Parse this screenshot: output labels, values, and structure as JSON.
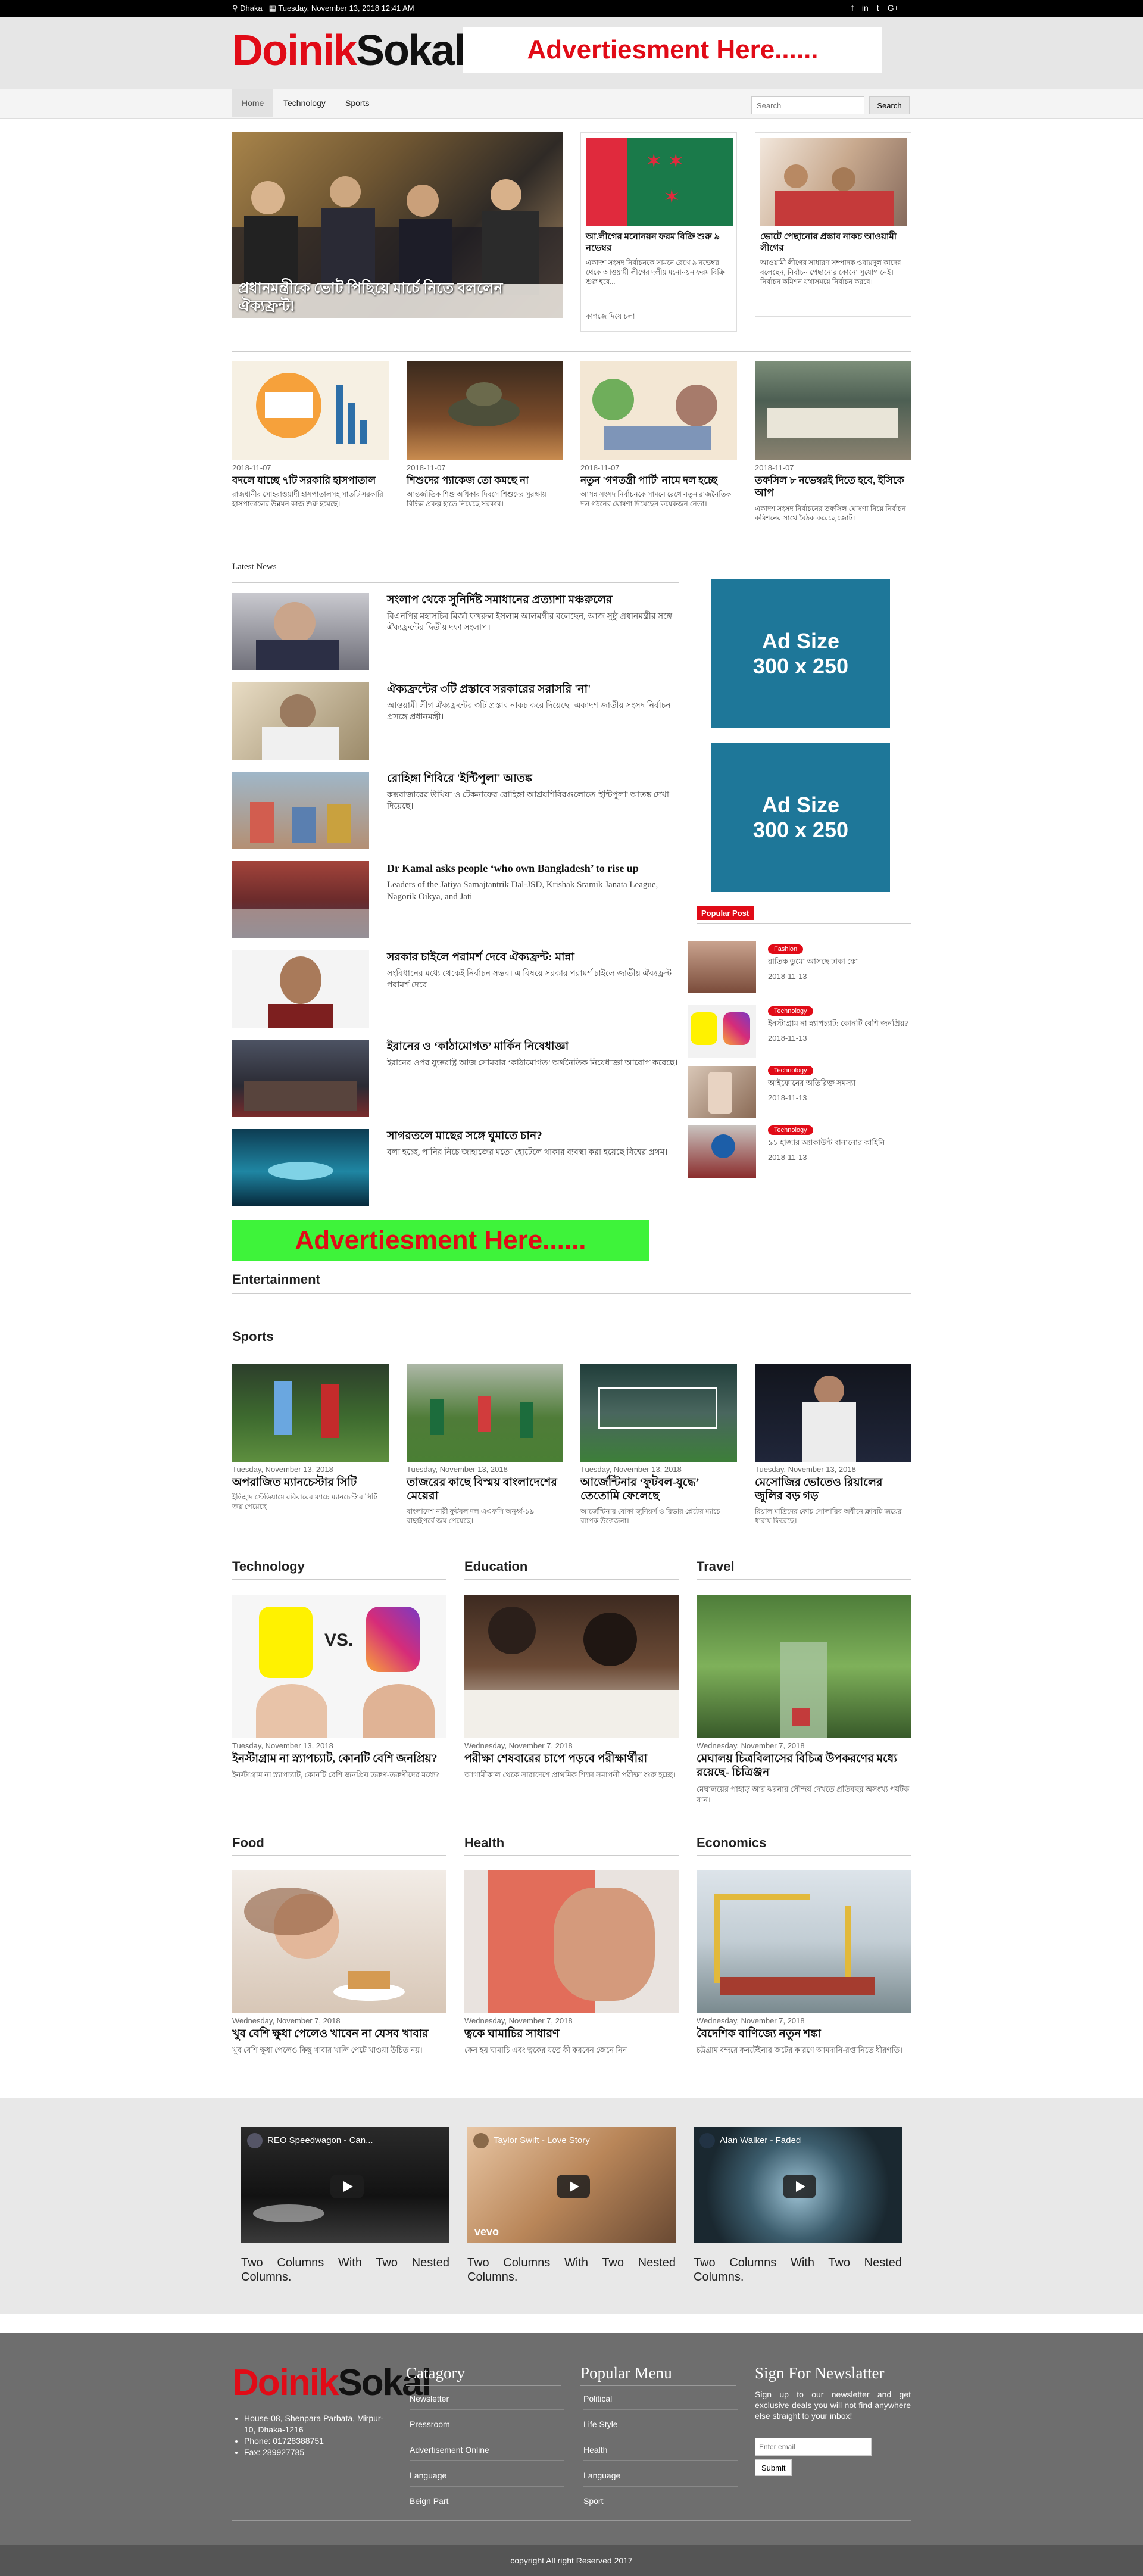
{
  "topbar": {
    "location": "Dhaka",
    "date": "Tuesday, November 13, 2018 12:41 AM",
    "social": [
      "f",
      "in",
      "t",
      "G+"
    ]
  },
  "brand": {
    "logo_red": "Doinik",
    "logo_black": "Sokal",
    "ad_top": "Advertiesment Here......"
  },
  "nav": {
    "items": [
      "Home",
      "Technology",
      "Sports"
    ],
    "search_placeholder": "Search",
    "search_button": "Search"
  },
  "lead": {
    "main_caption": "প্রধানমন্ত্রীকে ভোট পিছিয়ে মার্চে নিতে বললেন ঐক্যফ্রন্ট!",
    "cards": [
      {
        "title": "আ.লীগের মনোনয়ন ফরম বিক্রি শুরু ৯ নভেম্বর",
        "body": "একাদশ সংসদ নির্বাচনকে সামনে রেখে ৯ নভেম্বর থেকে আওয়ামী লীগের দলীয় মনোনয়ন ফরম বিক্রি শুরু হবে...",
        "date": "কাগজে দিয়ে চলা"
      },
      {
        "title": "ভোটে পেছানোর প্রস্তাব নাকচ আওয়ামী লীগের",
        "body": "আওয়ামী লীগের সাধারণ সম্পাদক ওবায়দুল কাদের বলেছেন, নির্বাচন পেছানোর কোনো সুযোগ নেই। নির্বাচন কমিশন যথাসময়ে নির্বাচন করবে।"
      }
    ]
  },
  "row1": [
    {
      "date": "2018-11-07",
      "title": "বদলে যাচ্ছে ৭টি সরকারি হাসপাতাল",
      "body": "রাজধানীর সোহরাওয়ার্দী হাসপাতালসহ সাতটি সরকারি হাসপাতালের উন্নয়ন কাজ শুরু হয়েছে।"
    },
    {
      "date": "2018-11-07",
      "title": "শিশুদের প্যাকেজ তো কমছে না",
      "body": "আন্তর্জাতিক শিশু অধিকার দিবসে শিশুদের সুরক্ষায় বিভিন্ন প্রকল্প হাতে নিয়েছে সরকার।"
    },
    {
      "date": "2018-11-07",
      "title": "নতুন 'গণতন্ত্রী পার্টি' নামে দল হচ্ছে",
      "body": "আসন্ন সংসদ নির্বাচনকে সামনে রেখে নতুন রাজনৈতিক দল গঠনের ঘোষণা দিয়েছেন কয়েকজন নেতা।"
    },
    {
      "date": "2018-11-07",
      "title": "তফসিল ৮ নভেম্বরই দিতে হবে, ইসিকে আপ",
      "body": "একাদশ সংসদ নির্বাচনের তফসিল ঘোষণা নিয়ে নির্বাচন কমিশনের সাথে বৈঠক করেছে জোট।"
    }
  ],
  "latest": {
    "heading": "Latest News",
    "items": [
      {
        "title": "সংলাপ থেকে সুনির্দিষ্ট সমাধানের প্রত্যাশা মঞ্চরুলের",
        "body": "বিএনপির মহাসচিব মির্জা ফখরুল ইসলাম আলমগীর বলেছেন, আজ সুষ্ঠু প্রধানমন্ত্রীর সঙ্গে ঐক্যফ্রন্টের দ্বিতীয় দফা সংলাপ।"
      },
      {
        "title": "ঐক্যফ্রন্টের ৩টি প্রস্তাবে সরকারের সরাসরি 'না'",
        "body": "আওয়ামী লীগ ঐক্যফ্রন্টের ৩টি প্রস্তাব নাকচ করে দিয়েছে। একাদশ জাতীয় সংসদ নির্বাচন প্রসঙ্গে প্রধানমন্ত্রী।"
      },
      {
        "title": "রোহিঙ্গা শিবিরে 'ইন্টিপুলা' আতঙ্ক",
        "body": "কক্সবাজারের উখিয়া ও টেকনাফের রোহিঙ্গা আশ্রয়শিবিরগুলোতে 'ইন্টিপুলা' আতঙ্ক দেখা দিয়েছে।"
      },
      {
        "title": "Dr Kamal asks people ‘who own Bangladesh’ to rise up",
        "body": "Leaders of the Jatiya Samajtantrik Dal-JSD, Krishak Sramik Janata League, Nagorik Oikya, and Jati"
      },
      {
        "title": "সরকার চাইলে পরামর্শ দেবে ঐক্যফ্রন্ট: মান্না",
        "body": "সংবিধানের মধ্যে থেকেই নির্বাচন সম্ভব। এ বিষয়ে সরকার পরামর্শ চাইলে জাতীয় ঐক্যফ্রন্ট পরামর্শ দেবে।"
      },
      {
        "title": "ইরানের ও ‘কাঠামোগত’ মার্কিন নিষেধাজ্ঞা",
        "body": "ইরানের ওপর যুক্তরাষ্ট্র আজ সোমবার ‘কাঠামোগত’ অর্থনৈতিক নিষেধাজ্ঞা আরোপ করেছে।"
      },
      {
        "title": "সাগরতলে মাছের সঙ্গে ঘুমাতে চান?",
        "body": "বলা হচ্ছে, পানির নিচে জাহাজের মতো হোটেলে থাকার ব্যবস্থা করা হয়েছে বিশ্বের প্রথম।"
      }
    ],
    "ad_bottom": "Advertiesment Here......"
  },
  "sidebar": {
    "ad_text": [
      "Ad Size",
      "300 x 250"
    ],
    "popular_label": "Popular Post",
    "popular": [
      {
        "badge": "Fashion",
        "title": "রাতিক ডুমো আসছে ঢাকা কো",
        "date": "2018-11-13"
      },
      {
        "badge": "Technology",
        "title": "ইনস্টাগ্রাম না স্ন্যাপচ্যাট: কোনটি বেশি জনপ্রিয়?",
        "date": "2018-11-13"
      },
      {
        "badge": "Technology",
        "title": "আইফোনের অতিরিক্ত সমস্যা",
        "date": "2018-11-13"
      },
      {
        "badge": "Technology",
        "title": "৯১ হাজার অ্যাকাউন্ট বানানোর কাহিনি",
        "date": "2018-11-13"
      }
    ]
  },
  "entertainment": {
    "heading": "Entertainment"
  },
  "sports": {
    "heading": "Sports",
    "items": [
      {
        "date": "Tuesday, November 13, 2018",
        "title": "অপরাজিত ম্যানচেস্টার সিটি",
        "body": "ইতিহাদ স্টেডিয়ামে রবিবারের ম্যাচে ম্যানচেস্টার সিটি জয় পেয়েছে।"
      },
      {
        "date": "Tuesday, November 13, 2018",
        "title": "তাজরের কাছে বিস্ময় বাংলাদেশের মেয়েরা",
        "body": "বাংলাদেশ নারী ফুটবল দল এএফসি অনূর্ধ্ব-১৯ বাছাইপর্বে জয় পেয়েছে।"
      },
      {
        "date": "Tuesday, November 13, 2018",
        "title": "আর্জেন্টিনার ‘ফুটবল-যুদ্ধে’ তেতোমি ফেলেছে",
        "body": "আর্জেন্টিনার বোকা জুনিয়র্স ও রিভার প্লেটের ম্যাচে ব্যাপক উত্তেজনা।"
      },
      {
        "date": "Tuesday, November 13, 2018",
        "title": "মেসোজির ভোতেও রিয়ালের জুলির বড় গড়",
        "body": "রিয়াল মাদ্রিদের কোচ সোলারির অধীনে ক্লাবটি জয়ের ধারায় ফিরেছে।"
      }
    ]
  },
  "categories": [
    {
      "heading": "Technology",
      "date": "Tuesday, November 13, 2018",
      "title": "ইনস্টাগ্রাম না স্ন্যাপচ্যাট, কোনটি বেশি জনপ্রিয়?",
      "body": "ইনস্টাগ্রাম না স্ন্যাপচ্যাট, কোনটি বেশি জনপ্রিয় তরুণ-তরুণীদের মধ্যে?"
    },
    {
      "heading": "Education",
      "date": "Wednesday, November 7, 2018",
      "title": "পরীক্ষা শেষবারের চাপে পড়বে পরীক্ষার্থীরা",
      "body": "আগামীকাল থেকে সারাদেশে প্রাথমিক শিক্ষা সমাপনী পরীক্ষা শুরু হচ্ছে।"
    },
    {
      "heading": "Travel",
      "date": "Wednesday, November 7, 2018",
      "title": "মেঘালয় চিত্রবিলাসের বিচিত্র উপকরণের মধ্যে রয়েছে- চিত্রিঞ্জন",
      "body": "মেঘালয়ের পাহাড় আর ঝরনার সৌন্দর্য দেখতে প্রতিবছর অসংখ্য পর্যটক যান।"
    },
    {
      "heading": "Food",
      "date": "Wednesday, November 7, 2018",
      "title": "খুব বেশি ক্ষুধা পেলেও খাবেন না যেসব খাবার",
      "body": "খুব বেশি ক্ষুধা পেলেও কিছু খাবার খালি পেটে খাওয়া উচিত নয়।"
    },
    {
      "heading": "Health",
      "date": "Wednesday, November 7, 2018",
      "title": "ত্বকে ঘামাচির সাধারণ",
      "body": "কেন হয় ঘামাচি এবং ত্বকের যত্নে কী করবেন জেনে নিন।"
    },
    {
      "heading": "Economics",
      "date": "Wednesday, November 7, 2018",
      "title": "বৈদেশিক বাণিজ্যে নতুন শঙ্কা",
      "body": "চট্টগ্রাম বন্দরে কনটেইনার জটের কারণে আমদানি-রপ্তানিতে ধীরগতি।"
    }
  ],
  "videos": [
    {
      "title": "REO Speedwagon - Can...",
      "caption": "Two Columns With Two Nested Columns."
    },
    {
      "title": "Taylor Swift - Love Story",
      "caption": "Two Columns With Two Nested Columns.",
      "brand": "vevo"
    },
    {
      "title": "Alan Walker - Faded",
      "caption": "Two Columns With Two Nested Columns."
    }
  ],
  "footer": {
    "address": [
      "House-08, Shenpara Parbata, Mirpur-10, Dhaka-1216",
      "Phone: 01728388751",
      "Fax: 289927785"
    ],
    "category_heading": "Catagory",
    "categories": [
      "Newsletter",
      "Pressroom",
      "Advertisement Online",
      "Language",
      "Beign Part"
    ],
    "menu_heading": "Popular Menu",
    "menu": [
      "Political",
      "Life Style",
      "Health",
      "Language",
      "Sport"
    ],
    "newsletter_heading": "Sign For Newslatter",
    "newsletter_text": "Sign up to our newsletter and get exclusive deals you will not find anywhere else straight to your inbox!",
    "email_placeholder": "Enter email",
    "submit": "Submit",
    "copyright": "copyright All right Reserved 2017"
  }
}
